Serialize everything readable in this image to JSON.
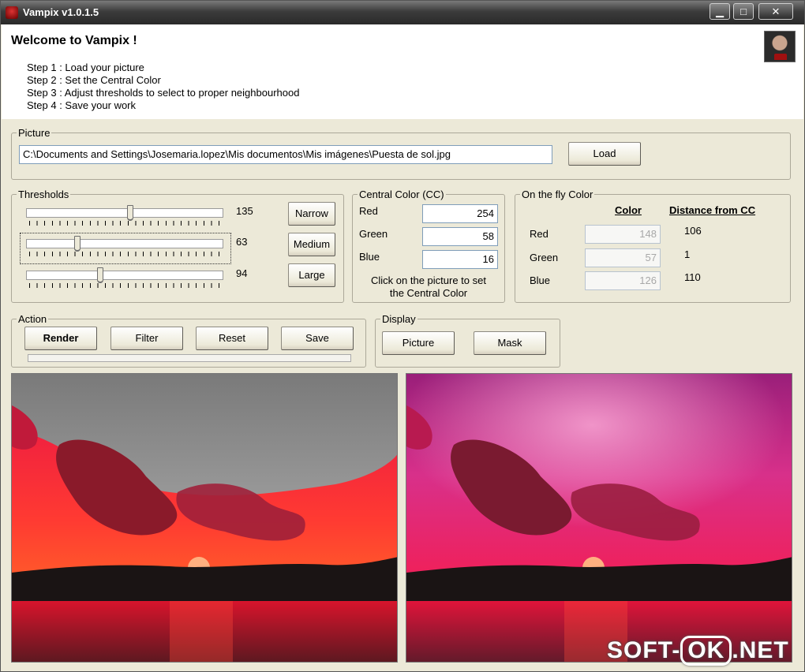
{
  "window": {
    "title": "Vampix v1.0.1.5",
    "controls": {
      "minimize": "▁",
      "maximize": "□",
      "close": "✕"
    }
  },
  "header": {
    "welcome": "Welcome to Vampix !",
    "steps": [
      "Step 1 : Load your picture",
      "Step 2 : Set the Central Color",
      "Step 3 : Adjust thresholds to select to proper neighbourhood",
      "Step 4 : Save your work"
    ]
  },
  "picture": {
    "label": "Picture",
    "path": "C:\\Documents and Settings\\Josemaria.lopez\\Mis documentos\\Mis imágenes\\Puesta de sol.jpg",
    "load_label": "Load"
  },
  "thresholds": {
    "label": "Thresholds",
    "sliders": [
      {
        "value": "135",
        "fraction": 0.53
      },
      {
        "value": "63",
        "fraction": 0.25
      },
      {
        "value": "94",
        "fraction": 0.37
      }
    ],
    "narrow_label": "Narrow",
    "medium_label": "Medium",
    "large_label": "Large"
  },
  "central_color": {
    "label": "Central Color (CC)",
    "red_label": "Red",
    "red": "254",
    "green_label": "Green",
    "green": "58",
    "blue_label": "Blue",
    "blue": "16",
    "hint_line1": "Click on the picture to set",
    "hint_line2": "the Central Color"
  },
  "on_the_fly": {
    "label": "On the fly Color",
    "color_header": "Color",
    "distance_header": "Distance from CC",
    "red_label": "Red",
    "red": "148",
    "red_distance": "106",
    "green_label": "Green",
    "green": "57",
    "green_distance": "1",
    "blue_label": "Blue",
    "blue": "126",
    "blue_distance": "110"
  },
  "action": {
    "label": "Action",
    "render_label": "Render",
    "filter_label": "Filter",
    "reset_label": "Reset",
    "save_label": "Save"
  },
  "display": {
    "label": "Display",
    "picture_label": "Picture",
    "mask_label": "Mask"
  },
  "watermark": {
    "left": "SOFT-",
    "ok": "OK",
    "right": ".NET"
  },
  "colors": {
    "window_bg": "#ece9d8",
    "sky_gray": "#8f8f8f",
    "sunset_red": "#e8123a",
    "sky_magenta": "#b0207a",
    "sea_red": "#c8102a"
  }
}
